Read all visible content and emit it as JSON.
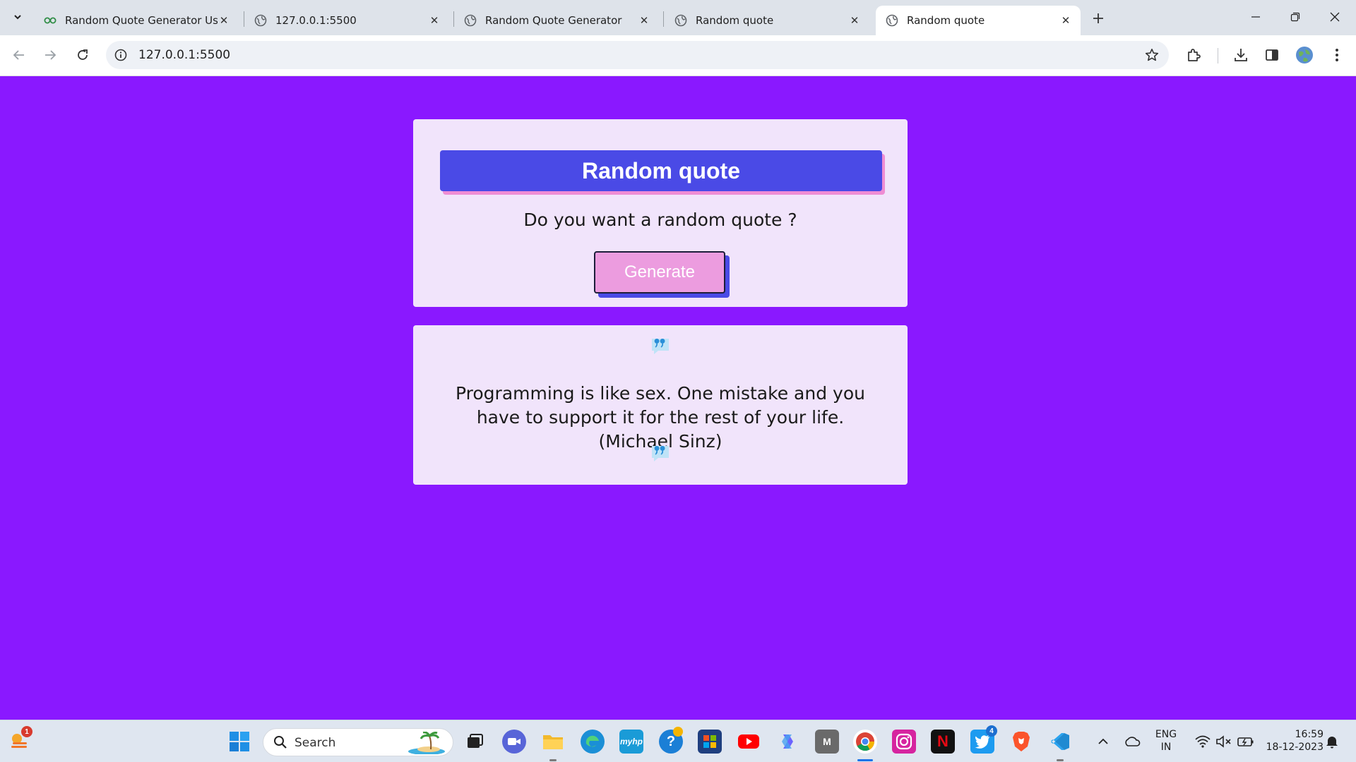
{
  "browser": {
    "tabs": [
      {
        "title": "Random Quote Generator Using",
        "favicon": "geeksforgeeks-icon",
        "active": false
      },
      {
        "title": "127.0.0.1:5500",
        "favicon": "globe-icon",
        "active": false
      },
      {
        "title": "Random Quote Generator",
        "favicon": "globe-icon",
        "active": false
      },
      {
        "title": "Random quote",
        "favicon": "globe-icon",
        "active": false
      },
      {
        "title": "Random quote",
        "favicon": "globe-icon",
        "active": true
      }
    ],
    "url": "127.0.0.1:5500"
  },
  "page": {
    "heading": "Random quote",
    "prompt": "Do you want a random quote ?",
    "generate_label": "Generate",
    "quote": "Programming is like sex. One mistake and you have to support it for the rest of your life. (Michael Sinz)",
    "colors": {
      "background": "#8a18ff",
      "card": "#f1e4fb",
      "banner": "#4a4ae6",
      "banner_shadow": "#ef8dd4",
      "button": "#ec9cdf"
    }
  },
  "taskbar": {
    "search_placeholder": "Search",
    "weather_badge": "1",
    "twitter_badge": "4",
    "language": "ENG",
    "region": "IN",
    "time": "16:59",
    "date": "18-12-2023"
  }
}
